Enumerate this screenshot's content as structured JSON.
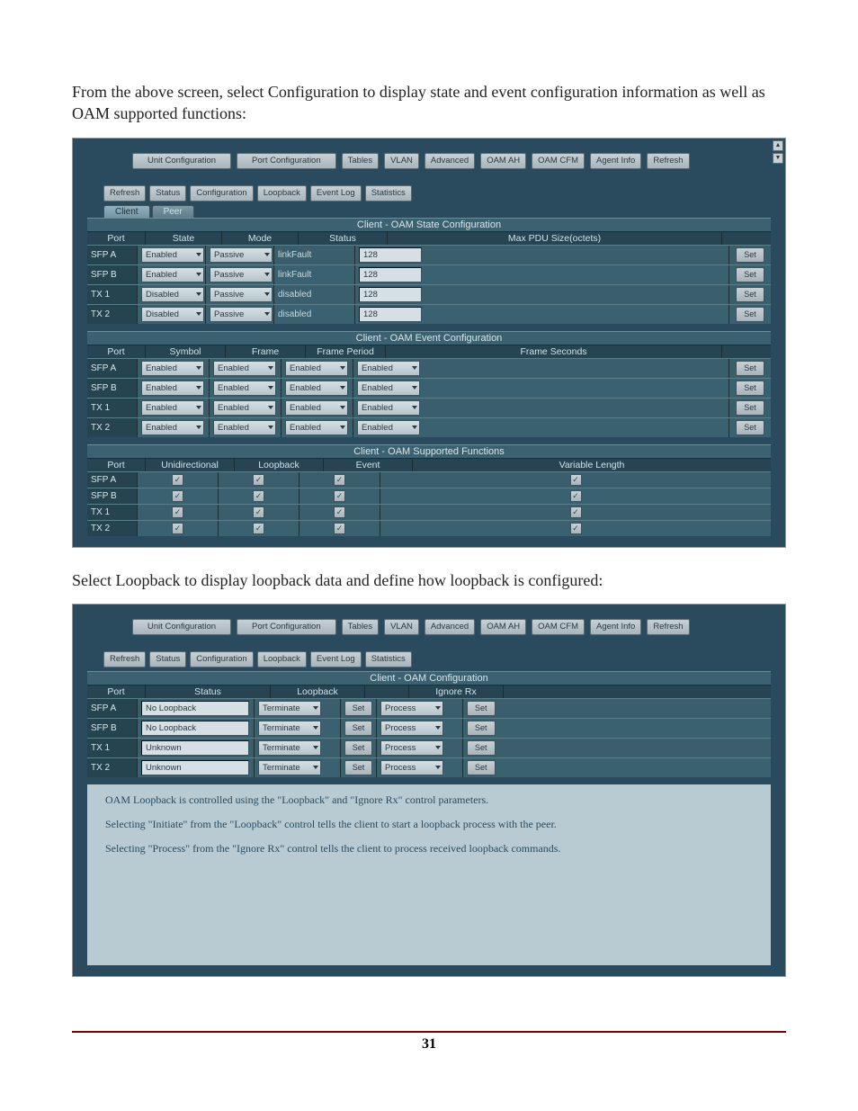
{
  "para1": "From the above screen, select Configuration to display state and event configuration information as well as OAM supported functions:",
  "para2": "Select Loopback to display loopback data and define how loopback is configured:",
  "pageNumber": "31",
  "topButtons": [
    "Unit Configuration",
    "Port Configuration",
    "Tables",
    "VLAN",
    "Advanced",
    "OAM AH",
    "OAM CFM",
    "Agent Info",
    "Refresh"
  ],
  "subButtons": [
    "Refresh",
    "Status",
    "Configuration",
    "Loopback",
    "Event Log",
    "Statistics"
  ],
  "tabs": {
    "client": "Client",
    "peer": "Peer"
  },
  "setLabel": "Set",
  "stateSection": {
    "band": "Client - OAM State Configuration",
    "headers": [
      "Port",
      "State",
      "Mode",
      "Status",
      "Max PDU Size(octets)"
    ],
    "rows": [
      {
        "port": "SFP A",
        "state": "Enabled",
        "mode": "Passive",
        "status": "linkFault",
        "pdu": "128"
      },
      {
        "port": "SFP B",
        "state": "Enabled",
        "mode": "Passive",
        "status": "linkFault",
        "pdu": "128"
      },
      {
        "port": "TX 1",
        "state": "Disabled",
        "mode": "Passive",
        "status": "disabled",
        "pdu": "128"
      },
      {
        "port": "TX 2",
        "state": "Disabled",
        "mode": "Passive",
        "status": "disabled",
        "pdu": "128"
      }
    ]
  },
  "eventSection": {
    "band": "Client - OAM Event Configuration",
    "headers": [
      "Port",
      "Symbol",
      "Frame",
      "Frame Period",
      "Frame Seconds"
    ],
    "rows": [
      {
        "port": "SFP A",
        "symbol": "Enabled",
        "frame": "Enabled",
        "fperiod": "Enabled",
        "fseconds": "Enabled"
      },
      {
        "port": "SFP B",
        "symbol": "Enabled",
        "frame": "Enabled",
        "fperiod": "Enabled",
        "fseconds": "Enabled"
      },
      {
        "port": "TX 1",
        "symbol": "Enabled",
        "frame": "Enabled",
        "fperiod": "Enabled",
        "fseconds": "Enabled"
      },
      {
        "port": "TX 2",
        "symbol": "Enabled",
        "frame": "Enabled",
        "fperiod": "Enabled",
        "fseconds": "Enabled"
      }
    ]
  },
  "funcSection": {
    "band": "Client - OAM Supported Functions",
    "headers": [
      "Port",
      "Unidirectional",
      "Loopback",
      "Event",
      "Variable Length"
    ],
    "rows": [
      {
        "port": "SFP A"
      },
      {
        "port": "SFP B"
      },
      {
        "port": "TX 1"
      },
      {
        "port": "TX 2"
      }
    ]
  },
  "loopSection": {
    "band": "Client - OAM Configuration",
    "headers": [
      "Port",
      "Status",
      "Loopback",
      "",
      "Ignore Rx",
      ""
    ],
    "rows": [
      {
        "port": "SFP A",
        "status": "No Loopback",
        "loopback": "Terminate",
        "ignore": "Process"
      },
      {
        "port": "SFP B",
        "status": "No Loopback",
        "loopback": "Terminate",
        "ignore": "Process"
      },
      {
        "port": "TX 1",
        "status": "Unknown",
        "loopback": "Terminate",
        "ignore": "Process"
      },
      {
        "port": "TX 2",
        "status": "Unknown",
        "loopback": "Terminate",
        "ignore": "Process"
      }
    ]
  },
  "help1": "OAM Loopback is controlled using the \"Loopback\" and \"Ignore Rx\" control parameters.",
  "help2": "Selecting \"Initiate\" from the \"Loopback\" control tells the client to start a loopback process with the peer.",
  "help3": "Selecting \"Process\" from the \"Ignore Rx\" control tells the client to process received loopback commands."
}
